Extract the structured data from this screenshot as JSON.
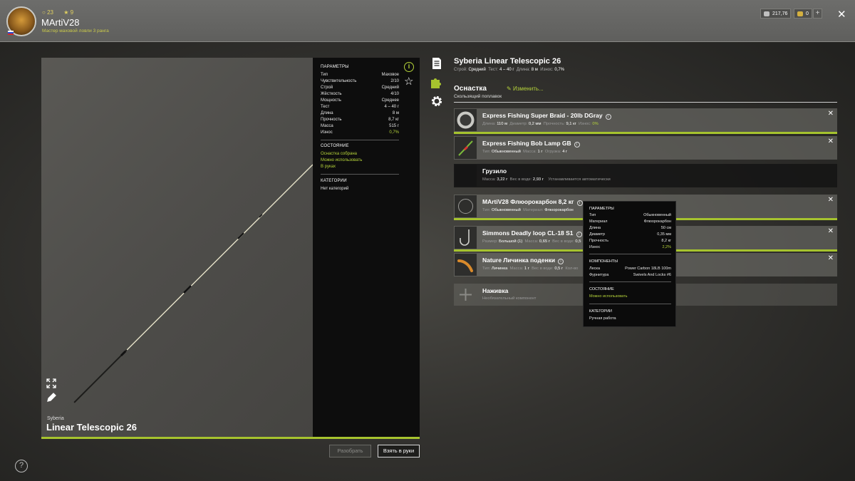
{
  "header": {
    "stat1": "23",
    "stat2": "9",
    "username": "MArtiV28",
    "rank": "Мастер маховой ловли 3 ранга",
    "silver": "217,76",
    "gold": "0",
    "plus": "+",
    "close": "✕"
  },
  "preview": {
    "brand": "Syberia",
    "rod_name": "Linear Telescopic 26"
  },
  "params": {
    "heading": "ПАРАМЕТРЫ",
    "rows": [
      {
        "label": "Тип",
        "value": "Маховое"
      },
      {
        "label": "Чувствительность",
        "value": "2/10"
      },
      {
        "label": "Строй",
        "value": "Средний"
      },
      {
        "label": "Жёсткость",
        "value": "4/10"
      },
      {
        "label": "Мощность",
        "value": "Среднее"
      },
      {
        "label": "Тест",
        "value": "4 – 40 г"
      },
      {
        "label": "Длина",
        "value": "8 м"
      },
      {
        "label": "Прочность",
        "value": "8,7 кг"
      },
      {
        "label": "Масса",
        "value": "515 г"
      },
      {
        "label": "Износ",
        "value": "0,7%"
      }
    ],
    "state_heading": "СОСТОЯНИЕ",
    "state1": "Оснастка собрана",
    "state2": "Можно использовать",
    "state3": "В руках",
    "cat_heading": "КАТЕГОРИИ",
    "cat_value": "Нет категорий"
  },
  "buttons": {
    "disassemble": "Разобрать",
    "take": "Взять в руки",
    "help": "?"
  },
  "right": {
    "title": "Syberia Linear Telescopic 26",
    "sub_label1": "Строй:",
    "sub_value1": "Средний",
    "sub_label2": "Тест:",
    "sub_value2": "4 – 40 г",
    "sub_label3": "Длина:",
    "sub_value3": "8 м",
    "sub_label4": "Износ:",
    "sub_value4": "0,7%",
    "osnastka": "Оснастка",
    "change": "Изменить...",
    "osnastka_sub": "Скользящий поплавок"
  },
  "slots": [
    {
      "name": "Express Fishing Super Braid - 20lb DGray",
      "l1": "Длина:",
      "v1": "110 м",
      "l2": "Диаметр:",
      "v2": "0,2 мм",
      "l3": "Прочность:",
      "v3": "9,1 кг",
      "l4": "Износ:",
      "v4": "0%"
    },
    {
      "name": "Express Fishing Bob Lamp GB",
      "l1": "Тип:",
      "v1": "Обыкновенный",
      "l2": "Масса:",
      "v2": "1 г",
      "l3": "Огрузка:",
      "v3": "4 г"
    },
    {
      "name": "Грузило",
      "l1": "Масса:",
      "v1": "3,22 г",
      "l2": "Вес в воде:",
      "v2": "2,93 г",
      "note": "Устанавливается автоматически"
    },
    {
      "name": "MArtiV28 Флюорокарбон 8,2 кг",
      "l1": "Тип:",
      "v1": "Обыкновенный",
      "l2": "Материал:",
      "v2": "Флюорокарбон"
    },
    {
      "name": "Simmons Deadly loop CL-18 S1",
      "l1": "Размер:",
      "v1": "Большой (1)",
      "l2": "Масса:",
      "v2": "0,65 г",
      "l3": "Вес в воде:",
      "v3": "0,5"
    },
    {
      "name": "Nature Личинка поденки",
      "l1": "Тип:",
      "v1": "Личинка",
      "l2": "Масса:",
      "v2": "1 г",
      "l3": "Вес в воде:",
      "v3": "0,5 г",
      "l4": "Кол-во"
    },
    {
      "name": "Наживка",
      "note": "Необязательный компонент"
    }
  ],
  "tooltip": {
    "heading": "ПАРАМЕТРЫ",
    "rows": [
      {
        "label": "Тип",
        "value": "Обыкновенный"
      },
      {
        "label": "Материал",
        "value": "Флюорокарбон"
      },
      {
        "label": "Длина",
        "value": "50 см"
      },
      {
        "label": "Диаметр",
        "value": "0,35 мм"
      },
      {
        "label": "Прочность",
        "value": "8,2 кг"
      },
      {
        "label": "Износ",
        "value": "2,2%"
      }
    ],
    "comp_heading": "КОМПОНЕНТЫ",
    "comp_rows": [
      {
        "label": "Леска",
        "value": "Power Carbon 18LB 100m"
      },
      {
        "label": "Фурнитура",
        "value": "Swivels And Locks #6"
      }
    ],
    "state_heading": "СОСТОЯНИЕ",
    "state_value": "Можно использовать",
    "cat_heading": "КАТЕГОРИИ",
    "cat_value": "Ручная работа"
  },
  "colors": {
    "accent": "#a6c32e",
    "accent_text": "#b5d33a"
  }
}
